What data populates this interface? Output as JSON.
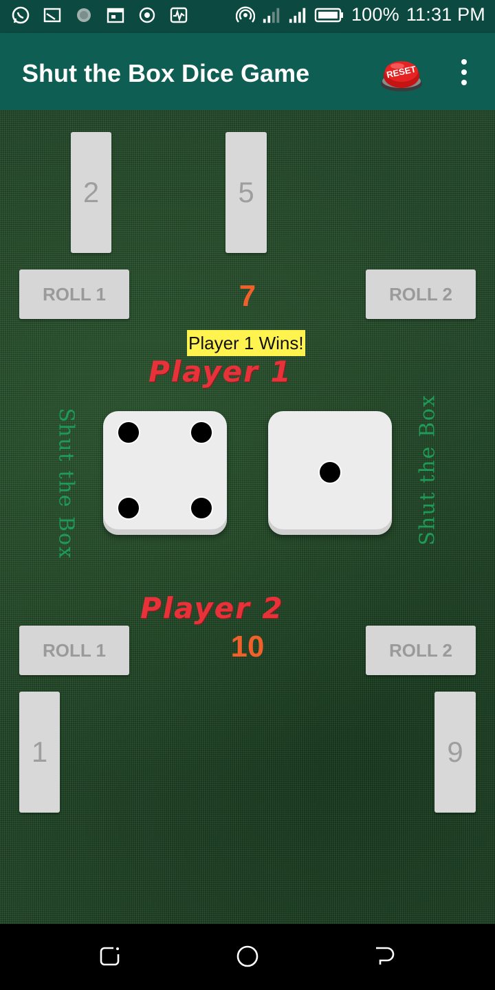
{
  "status_bar": {
    "battery": "100%",
    "time": "11:31 PM",
    "left_icons": [
      "whatsapp-icon",
      "cast-icon",
      "sphere-icon",
      "calendar-icon",
      "record-icon",
      "activity-icon"
    ],
    "right_icons": [
      "hotspot-icon",
      "signal-icon",
      "signal-icon",
      "battery-icon"
    ]
  },
  "appbar": {
    "title": "Shut the Box Dice Game",
    "reset_label": "RESET"
  },
  "board": {
    "top_tiles": [
      "2",
      "5"
    ],
    "player1": {
      "label": "Player 1",
      "roll1": "ROLL 1",
      "roll2": "ROLL 2",
      "score": "7",
      "status": "Player 1 Wins!"
    },
    "player2": {
      "label": "Player 2",
      "roll1": "ROLL 1",
      "roll2": "ROLL 2",
      "score": "10"
    },
    "bottom_tiles": [
      "1",
      "9"
    ],
    "side_text_left": "Shut the Box",
    "side_text_right": "Shut the Box",
    "dice": [
      4,
      1
    ]
  },
  "colors": {
    "appbar": "#0f5e54",
    "statusbar": "#0c4a41",
    "score": "#f0602a",
    "player_label": "#e8323a",
    "win_bg": "#fff44f"
  }
}
